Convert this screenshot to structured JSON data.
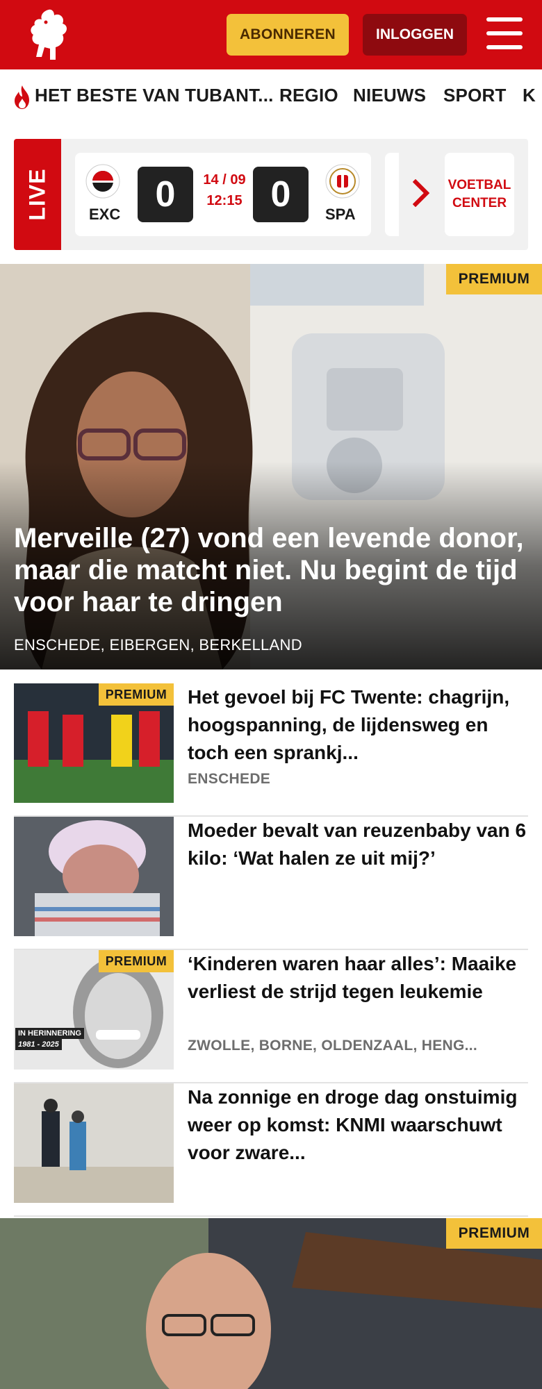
{
  "header": {
    "subscribe_label": "ABONNEREN",
    "login_label": "INLOGGEN",
    "brand_color": "#d10a11",
    "accent_color": "#f3c13a",
    "logo_icon": "tubantia-horse-logo",
    "menu_icon": "hamburger-menu-icon"
  },
  "nav": {
    "items": [
      "HET BESTE VAN TUBANT...",
      "REGIO",
      "NIEUWS",
      "SPORT",
      "K"
    ]
  },
  "live": {
    "label": "LIVE",
    "match": {
      "home_code": "EXC",
      "away_code": "SPA",
      "home_score": "0",
      "away_score": "0",
      "date": "14 / 09",
      "time": "12:15"
    },
    "voetbal_center_line1": "VOETBAL",
    "voetbal_center_line2": "CENTER"
  },
  "hero": {
    "badge": "PREMIUM",
    "title": "Merveille (27) vond een levende donor, maar die matcht niet. Nu begint de tijd voor haar te dringen",
    "location": "ENSCHEDE, EIBERGEN, BERKELLAND"
  },
  "articles": [
    {
      "badge": "PREMIUM",
      "title": "Het gevoel bij FC Twente: chagrijn, hoogspanning, de lijdensweg en toch een sprankj...",
      "location": "ENSCHEDE"
    },
    {
      "badge": "",
      "title": "Moeder bevalt van reuzenbaby van 6 kilo: ‘Wat halen ze uit mij?’",
      "location": ""
    },
    {
      "badge": "PREMIUM",
      "title": "‘Kinderen waren haar alles’: Maaike verliest de strijd tegen leukemie",
      "location": "ZWOLLE, BORNE, OLDENZAAL, HENG...",
      "thumb_caption_1": "IN HERINNERING",
      "thumb_caption_2": "1981 - 2025"
    },
    {
      "badge": "",
      "title": "Na zonnige en droge dag onstuimig weer op komst: KNMI waarschuwt voor zware...",
      "location": ""
    }
  ],
  "hero2": {
    "badge": "PREMIUM"
  }
}
